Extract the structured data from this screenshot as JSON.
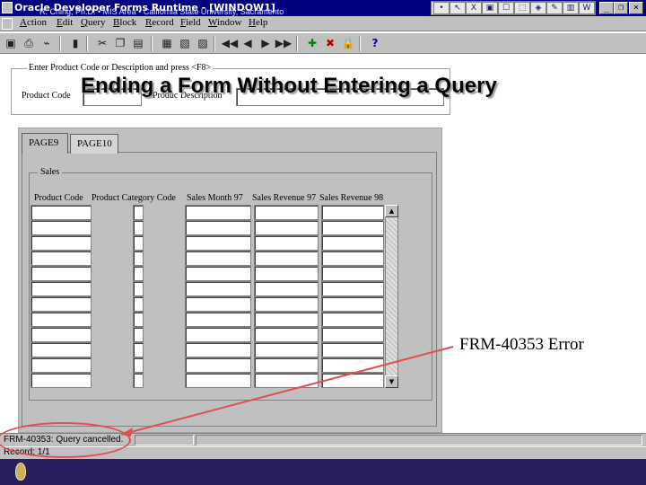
{
  "window": {
    "title": "Oracle Developer Forms Runtime - [WINDOW1]",
    "controls": {
      "minimize": "_",
      "restore": "❐",
      "close": "×"
    }
  },
  "tray": {
    "icons": [
      "pin",
      "arrow",
      "excel",
      "mail",
      "window",
      "chart",
      "window2",
      "pen",
      "image",
      "word"
    ],
    "labels": [
      "•",
      "↖",
      "X",
      "▣",
      "☐",
      "⬚",
      "◈",
      "✎",
      "▥",
      "W"
    ]
  },
  "menu": {
    "items": [
      "Action",
      "Edit",
      "Query",
      "Block",
      "Record",
      "Field",
      "Window",
      "Help"
    ]
  },
  "toolbar": {
    "buttons": [
      {
        "name": "save-icon",
        "glyph": "▣"
      },
      {
        "name": "print-icon",
        "glyph": "⎙"
      },
      {
        "name": "print-setup-icon",
        "glyph": "⌁"
      },
      {
        "name": "exit-icon",
        "glyph": "▮"
      },
      {
        "name": "cut-icon",
        "glyph": "✂"
      },
      {
        "name": "copy-icon",
        "glyph": "❐"
      },
      {
        "name": "paste-icon",
        "glyph": "▤"
      },
      {
        "name": "enter-query-icon",
        "glyph": "▦"
      },
      {
        "name": "execute-query-icon",
        "glyph": "▧"
      },
      {
        "name": "cancel-query-icon",
        "glyph": "▨"
      },
      {
        "name": "first-record-icon",
        "glyph": "◀◀"
      },
      {
        "name": "previous-record-icon",
        "glyph": "◀"
      },
      {
        "name": "next-record-icon",
        "glyph": "▶"
      },
      {
        "name": "last-record-icon",
        "glyph": "▶▶"
      },
      {
        "name": "insert-record-icon",
        "glyph": "✚"
      },
      {
        "name": "delete-record-icon",
        "glyph": "✖"
      },
      {
        "name": "lock-record-icon",
        "glyph": "🔒"
      },
      {
        "name": "help-icon",
        "glyph": "?"
      }
    ]
  },
  "query_frame": {
    "label": "Enter Product Code or Description and press <F8>",
    "product_code_label": "Product Code",
    "product_description_label": "Produc Description"
  },
  "slide": {
    "title": "Ending a Form Without Entering a Query"
  },
  "tabs": [
    {
      "label": "PAGE9"
    },
    {
      "label": "PAGE10"
    }
  ],
  "sales": {
    "label": "Sales",
    "columns": [
      "Product Code",
      "Product Category Code",
      "Sales Month 97",
      "Sales Revenue 97",
      "Sales Revenue 98"
    ],
    "row_count": 12
  },
  "status": {
    "message": "FRM-40353: Query cancelled.",
    "record": "Record: 1/1"
  },
  "annotation": {
    "text": "FRM-40353 Error"
  },
  "footer": {
    "text": "R. Ching, Ph.D. • MIS Area • California State University, Sacramento"
  }
}
